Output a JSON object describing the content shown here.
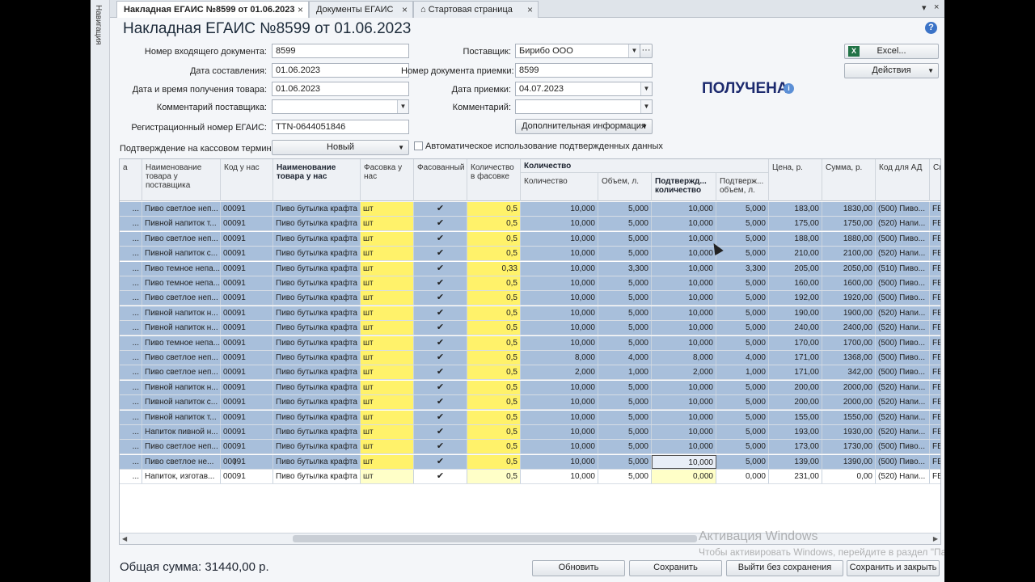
{
  "nav": {
    "label": "Навигация"
  },
  "tabs": [
    {
      "label": "Накладная ЕГАИС №8599 от 01.06.2023",
      "active": true
    },
    {
      "label": "Документы ЕГАИС",
      "active": false
    },
    {
      "label": "Стартовая страница",
      "active": false
    }
  ],
  "tabbar_icons": {
    "home": "home-icon",
    "menu": "▾",
    "close": "×"
  },
  "title": "Накладная ЕГАИС №8599 от 01.06.2023",
  "help": "?",
  "form": {
    "incoming_number_label": "Номер входящего документа:",
    "incoming_number": "8599",
    "date_compiled_label": "Дата составления:",
    "date_compiled": "01.06.2023",
    "received_datetime_label": "Дата и время получения товара:",
    "received_datetime": "01.06.2023",
    "supplier_comment_label": "Комментарий поставщика:",
    "supplier_comment": "",
    "egais_reg_label": "Регистрационный номер ЕГАИС:",
    "egais_reg": "TTN-0644051846",
    "cashier_confirm_label": "Подтверждение на кассовом терминале:",
    "cashier_confirm": "Новый",
    "supplier_label": "Поставщик:",
    "supplier": "Бирибо ООО",
    "receipt_number_label": "Номер документа приемки:",
    "receipt_number": "8599",
    "receipt_date_label": "Дата приемки:",
    "receipt_date": "04.07.2023",
    "comment_label": "Комментарий:",
    "comment": "",
    "extra_info_button": "Дополнительная информация",
    "auto_use_label": "Автоматическое использование подтвержденных данных",
    "ellipsis": "···"
  },
  "buttons": {
    "excel": "Excel...",
    "actions": "Действия",
    "refresh": "Обновить",
    "save": "Сохранить",
    "exit_nosave": "Выйти без сохранения",
    "save_close": "Сохранить и закрыть"
  },
  "status": "ПОЛУЧЕНА",
  "table": {
    "group_header": "Количество",
    "columns": [
      "а",
      "Наименование товара у поставщика",
      "Код у нас",
      "Наименование товара у нас",
      "Фасовка у нас",
      "Фасованный",
      "Количество в фасовке",
      "Количество",
      "Объем, л.",
      "Подтвержд... количество",
      "Подтверж... объем, л.",
      "Цена, р.",
      "Сумма, р.",
      "Код для АД",
      "Сп"
    ],
    "rows": [
      [
        "Пиво светлое неп...",
        "00091",
        "Пиво бутылка крафта",
        "шт",
        "0,5",
        "10,000",
        "5,000",
        "10,000",
        "5,000",
        "183,00",
        "1830,00",
        "(500) Пиво...",
        "FB"
      ],
      [
        "Пивной напиток т...",
        "00091",
        "Пиво бутылка крафта",
        "шт",
        "0,5",
        "10,000",
        "5,000",
        "10,000",
        "5,000",
        "175,00",
        "1750,00",
        "(520) Напи...",
        "FB"
      ],
      [
        "Пиво светлое неп...",
        "00091",
        "Пиво бутылка крафта",
        "шт",
        "0,5",
        "10,000",
        "5,000",
        "10,000",
        "5,000",
        "188,00",
        "1880,00",
        "(500) Пиво...",
        "FB"
      ],
      [
        "Пивной напиток с...",
        "00091",
        "Пиво бутылка крафта",
        "шт",
        "0,5",
        "10,000",
        "5,000",
        "10,000",
        "5,000",
        "210,00",
        "2100,00",
        "(520) Напи...",
        "FB"
      ],
      [
        "Пиво темное непа...",
        "00091",
        "Пиво бутылка крафта",
        "шт",
        "0,33",
        "10,000",
        "3,300",
        "10,000",
        "3,300",
        "205,00",
        "2050,00",
        "(510) Пиво...",
        "FB"
      ],
      [
        "Пиво темное непа...",
        "00091",
        "Пиво бутылка крафта",
        "шт",
        "0,5",
        "10,000",
        "5,000",
        "10,000",
        "5,000",
        "160,00",
        "1600,00",
        "(500) Пиво...",
        "FB"
      ],
      [
        "Пиво светлое неп...",
        "00091",
        "Пиво бутылка крафта",
        "шт",
        "0,5",
        "10,000",
        "5,000",
        "10,000",
        "5,000",
        "192,00",
        "1920,00",
        "(500) Пиво...",
        "FB"
      ],
      [
        "Пивной напиток н...",
        "00091",
        "Пиво бутылка крафта",
        "шт",
        "0,5",
        "10,000",
        "5,000",
        "10,000",
        "5,000",
        "190,00",
        "1900,00",
        "(520) Напи...",
        "FB"
      ],
      [
        "Пивной напиток н...",
        "00091",
        "Пиво бутылка крафта",
        "шт",
        "0,5",
        "10,000",
        "5,000",
        "10,000",
        "5,000",
        "240,00",
        "2400,00",
        "(520) Напи...",
        "FB"
      ],
      [
        "Пиво темное непа...",
        "00091",
        "Пиво бутылка крафта",
        "шт",
        "0,5",
        "10,000",
        "5,000",
        "10,000",
        "5,000",
        "170,00",
        "1700,00",
        "(500) Пиво...",
        "FB"
      ],
      [
        "Пиво светлое неп...",
        "00091",
        "Пиво бутылка крафта",
        "шт",
        "0,5",
        "8,000",
        "4,000",
        "8,000",
        "4,000",
        "171,00",
        "1368,00",
        "(500) Пиво...",
        "FB"
      ],
      [
        "Пиво светлое неп...",
        "00091",
        "Пиво бутылка крафта",
        "шт",
        "0,5",
        "2,000",
        "1,000",
        "2,000",
        "1,000",
        "171,00",
        "342,00",
        "(500) Пиво...",
        "FB"
      ],
      [
        "Пивной напиток н...",
        "00091",
        "Пиво бутылка крафта",
        "шт",
        "0,5",
        "10,000",
        "5,000",
        "10,000",
        "5,000",
        "200,00",
        "2000,00",
        "(520) Напи...",
        "FB"
      ],
      [
        "Пивной напиток с...",
        "00091",
        "Пиво бутылка крафта",
        "шт",
        "0,5",
        "10,000",
        "5,000",
        "10,000",
        "5,000",
        "200,00",
        "2000,00",
        "(520) Напи...",
        "FB"
      ],
      [
        "Пивной напиток т...",
        "00091",
        "Пиво бутылка крафта",
        "шт",
        "0,5",
        "10,000",
        "5,000",
        "10,000",
        "5,000",
        "155,00",
        "1550,00",
        "(520) Напи...",
        "FB"
      ],
      [
        "Напиток пивной н...",
        "00091",
        "Пиво бутылка крафта",
        "шт",
        "0,5",
        "10,000",
        "5,000",
        "10,000",
        "5,000",
        "193,00",
        "1930,00",
        "(520) Напи...",
        "FB"
      ],
      [
        "Пиво светлое неп...",
        "00091",
        "Пиво бутылка крафта",
        "шт",
        "0,5",
        "10,000",
        "5,000",
        "10,000",
        "5,000",
        "173,00",
        "1730,00",
        "(500) Пиво...",
        "FB"
      ],
      [
        "Пиво светлое не...",
        "00091",
        "Пиво бутылка крафта",
        "шт",
        "0,5",
        "10,000",
        "5,000",
        "10,000",
        "5,000",
        "139,00",
        "1390,00",
        "(500) Пиво...",
        "FB"
      ],
      [
        "Напиток, изготав...",
        "00091",
        "Пиво бутылка крафта",
        "шт",
        "0,5",
        "10,000",
        "5,000",
        "0,000",
        "0,000",
        "231,00",
        "0,00",
        "(520) Напи...",
        "FB"
      ]
    ],
    "check_glyph": "✔",
    "dots": "..."
  },
  "total": "Общая сумма: 31440,00 р.",
  "watermark": {
    "line1": "Активация Windows",
    "line2": "Чтобы активировать Windows, перейдите в раздел \"Параметры\"."
  },
  "colors": {
    "selected_row": "#a8bfdb",
    "yellow_cell": "#fff26a",
    "status": "#1c2a6e"
  }
}
